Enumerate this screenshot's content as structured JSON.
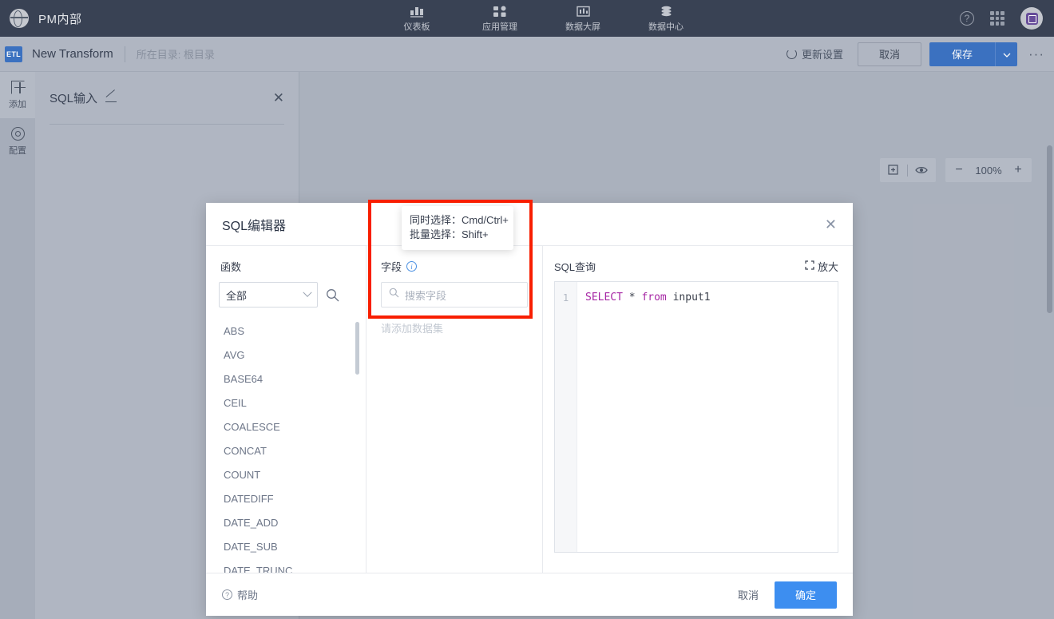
{
  "topnav": {
    "brand": "PM内部",
    "brand_icon": "globe-icon",
    "items": [
      {
        "label": "仪表板",
        "icon": "bar-chart-icon"
      },
      {
        "label": "应用管理",
        "icon": "apps-grid-icon"
      },
      {
        "label": "数据大屏",
        "icon": "dashboard-screen-icon"
      },
      {
        "label": "数据中心",
        "icon": "database-stack-icon"
      }
    ],
    "help_icon": "question-circle-icon",
    "apps_icon": "grid-menu-icon",
    "avatar_icon": "user-avatar-icon",
    "bg_color": "#3b4456"
  },
  "subbar": {
    "badge": "ETL",
    "title": "New Transform",
    "directory_label": "所在目录: 根目录",
    "refresh_label": "更新设置",
    "cancel_label": "取消",
    "save_label": "保存",
    "more_label": "···",
    "primary_color": "#3d74c4"
  },
  "rail": {
    "items": [
      {
        "label": "添加",
        "icon": "add-node-icon",
        "active": true
      },
      {
        "label": "配置",
        "icon": "gear-icon",
        "active": false
      }
    ]
  },
  "sql_input_panel": {
    "title": "SQL输入",
    "edit_icon": "pencil-icon",
    "close_icon": "close-icon"
  },
  "canvas_tools": {
    "fit_icon": "fit-to-screen-icon",
    "preview_icon": "eye-icon",
    "zoom_out": "−",
    "zoom_level": "100%",
    "zoom_in": "+"
  },
  "modal": {
    "title": "SQL编辑器",
    "close_icon": "close-icon",
    "functions": {
      "label": "函数",
      "select_value": "全部",
      "search_icon": "search-icon",
      "items": [
        "ABS",
        "AVG",
        "BASE64",
        "CEIL",
        "COALESCE",
        "CONCAT",
        "COUNT",
        "DATEDIFF",
        "DATE_ADD",
        "DATE_SUB",
        "DATE_TRUNC"
      ]
    },
    "fields": {
      "label": "字段",
      "info_icon": "info-circle-icon",
      "search_placeholder": "搜索字段",
      "search_value": "",
      "empty_hint": "请添加数据集"
    },
    "sql": {
      "label": "SQL查询",
      "expand_label": "放大",
      "expand_icon": "expand-icon",
      "line_number": "1",
      "code_keyword_1": "SELECT",
      "code_op": "*",
      "code_keyword_2": "from",
      "code_identifier": "input1"
    },
    "footer": {
      "help_label": "帮助",
      "help_icon": "question-circle-icon",
      "cancel_label": "取消",
      "confirm_label": "确定",
      "confirm_color": "#3d8ef0"
    }
  },
  "tooltip": {
    "line1": "同时选择：Cmd/Ctrl+",
    "line2": "批量选择：Shift+"
  },
  "highlight": {
    "color": "#f81e00"
  }
}
